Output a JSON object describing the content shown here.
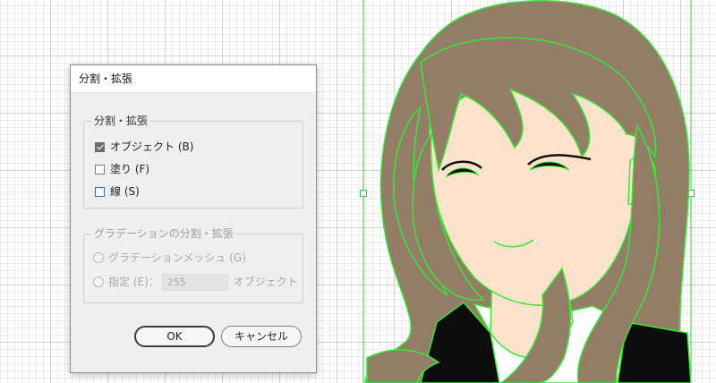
{
  "dialog": {
    "title": "分割・拡張",
    "split_group": {
      "label": "分割・拡張",
      "options": [
        {
          "label": "オブジェクト (B)",
          "checked": true
        },
        {
          "label": "塗り (F)",
          "checked": false
        },
        {
          "label": "線 (S)",
          "checked": false
        }
      ]
    },
    "gradient_group": {
      "label": "グラデーションの分割・拡張",
      "mesh_label": "グラデーションメッシュ (G)",
      "specify_label": "指定 (E)：",
      "specify_value": "255",
      "objects_label": "オブジェクト"
    },
    "ok_label": "OK",
    "cancel_label": "キャンセル"
  },
  "colors": {
    "hair": "#937d66",
    "skin": "#fde3cc",
    "outline": "#39e639",
    "jacket": "#0d0d0d",
    "shirt": "#ffffff",
    "selection": "#2ecc40"
  }
}
